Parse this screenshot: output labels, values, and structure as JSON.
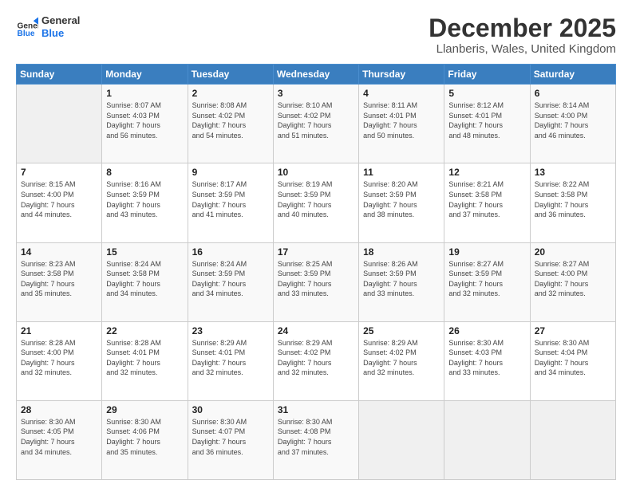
{
  "logo": {
    "line1": "General",
    "line2": "Blue"
  },
  "title": "December 2025",
  "subtitle": "Llanberis, Wales, United Kingdom",
  "weekdays": [
    "Sunday",
    "Monday",
    "Tuesday",
    "Wednesday",
    "Thursday",
    "Friday",
    "Saturday"
  ],
  "weeks": [
    [
      {
        "day": "",
        "info": ""
      },
      {
        "day": "1",
        "info": "Sunrise: 8:07 AM\nSunset: 4:03 PM\nDaylight: 7 hours\nand 56 minutes."
      },
      {
        "day": "2",
        "info": "Sunrise: 8:08 AM\nSunset: 4:02 PM\nDaylight: 7 hours\nand 54 minutes."
      },
      {
        "day": "3",
        "info": "Sunrise: 8:10 AM\nSunset: 4:02 PM\nDaylight: 7 hours\nand 51 minutes."
      },
      {
        "day": "4",
        "info": "Sunrise: 8:11 AM\nSunset: 4:01 PM\nDaylight: 7 hours\nand 50 minutes."
      },
      {
        "day": "5",
        "info": "Sunrise: 8:12 AM\nSunset: 4:01 PM\nDaylight: 7 hours\nand 48 minutes."
      },
      {
        "day": "6",
        "info": "Sunrise: 8:14 AM\nSunset: 4:00 PM\nDaylight: 7 hours\nand 46 minutes."
      }
    ],
    [
      {
        "day": "7",
        "info": "Sunrise: 8:15 AM\nSunset: 4:00 PM\nDaylight: 7 hours\nand 44 minutes."
      },
      {
        "day": "8",
        "info": "Sunrise: 8:16 AM\nSunset: 3:59 PM\nDaylight: 7 hours\nand 43 minutes."
      },
      {
        "day": "9",
        "info": "Sunrise: 8:17 AM\nSunset: 3:59 PM\nDaylight: 7 hours\nand 41 minutes."
      },
      {
        "day": "10",
        "info": "Sunrise: 8:19 AM\nSunset: 3:59 PM\nDaylight: 7 hours\nand 40 minutes."
      },
      {
        "day": "11",
        "info": "Sunrise: 8:20 AM\nSunset: 3:59 PM\nDaylight: 7 hours\nand 38 minutes."
      },
      {
        "day": "12",
        "info": "Sunrise: 8:21 AM\nSunset: 3:58 PM\nDaylight: 7 hours\nand 37 minutes."
      },
      {
        "day": "13",
        "info": "Sunrise: 8:22 AM\nSunset: 3:58 PM\nDaylight: 7 hours\nand 36 minutes."
      }
    ],
    [
      {
        "day": "14",
        "info": "Sunrise: 8:23 AM\nSunset: 3:58 PM\nDaylight: 7 hours\nand 35 minutes."
      },
      {
        "day": "15",
        "info": "Sunrise: 8:24 AM\nSunset: 3:58 PM\nDaylight: 7 hours\nand 34 minutes."
      },
      {
        "day": "16",
        "info": "Sunrise: 8:24 AM\nSunset: 3:59 PM\nDaylight: 7 hours\nand 34 minutes."
      },
      {
        "day": "17",
        "info": "Sunrise: 8:25 AM\nSunset: 3:59 PM\nDaylight: 7 hours\nand 33 minutes."
      },
      {
        "day": "18",
        "info": "Sunrise: 8:26 AM\nSunset: 3:59 PM\nDaylight: 7 hours\nand 33 minutes."
      },
      {
        "day": "19",
        "info": "Sunrise: 8:27 AM\nSunset: 3:59 PM\nDaylight: 7 hours\nand 32 minutes."
      },
      {
        "day": "20",
        "info": "Sunrise: 8:27 AM\nSunset: 4:00 PM\nDaylight: 7 hours\nand 32 minutes."
      }
    ],
    [
      {
        "day": "21",
        "info": "Sunrise: 8:28 AM\nSunset: 4:00 PM\nDaylight: 7 hours\nand 32 minutes."
      },
      {
        "day": "22",
        "info": "Sunrise: 8:28 AM\nSunset: 4:01 PM\nDaylight: 7 hours\nand 32 minutes."
      },
      {
        "day": "23",
        "info": "Sunrise: 8:29 AM\nSunset: 4:01 PM\nDaylight: 7 hours\nand 32 minutes."
      },
      {
        "day": "24",
        "info": "Sunrise: 8:29 AM\nSunset: 4:02 PM\nDaylight: 7 hours\nand 32 minutes."
      },
      {
        "day": "25",
        "info": "Sunrise: 8:29 AM\nSunset: 4:02 PM\nDaylight: 7 hours\nand 32 minutes."
      },
      {
        "day": "26",
        "info": "Sunrise: 8:30 AM\nSunset: 4:03 PM\nDaylight: 7 hours\nand 33 minutes."
      },
      {
        "day": "27",
        "info": "Sunrise: 8:30 AM\nSunset: 4:04 PM\nDaylight: 7 hours\nand 34 minutes."
      }
    ],
    [
      {
        "day": "28",
        "info": "Sunrise: 8:30 AM\nSunset: 4:05 PM\nDaylight: 7 hours\nand 34 minutes."
      },
      {
        "day": "29",
        "info": "Sunrise: 8:30 AM\nSunset: 4:06 PM\nDaylight: 7 hours\nand 35 minutes."
      },
      {
        "day": "30",
        "info": "Sunrise: 8:30 AM\nSunset: 4:07 PM\nDaylight: 7 hours\nand 36 minutes."
      },
      {
        "day": "31",
        "info": "Sunrise: 8:30 AM\nSunset: 4:08 PM\nDaylight: 7 hours\nand 37 minutes."
      },
      {
        "day": "",
        "info": ""
      },
      {
        "day": "",
        "info": ""
      },
      {
        "day": "",
        "info": ""
      }
    ]
  ]
}
